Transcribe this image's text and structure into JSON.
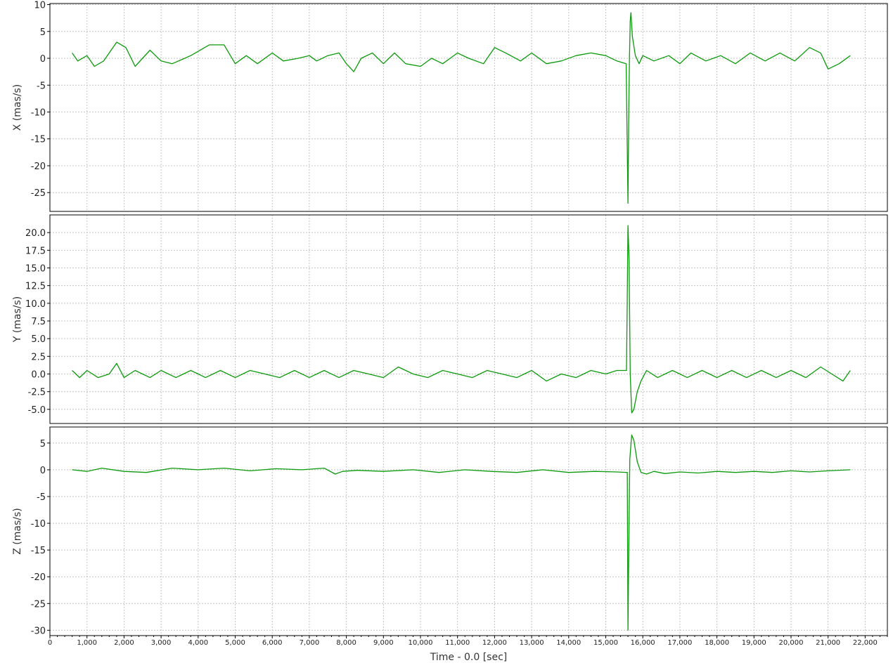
{
  "colors": {
    "series": "#0b9a0b",
    "grid": "#c4c4c4",
    "frame": "#000000"
  },
  "chart_data": {
    "type": "line",
    "grid": true,
    "legend": "none",
    "xlabel": "Time - 0.0 [sec]",
    "xlim": [
      0,
      22600
    ],
    "xticks": [
      0,
      1000,
      2000,
      3000,
      4000,
      5000,
      6000,
      7000,
      8000,
      9000,
      10000,
      11000,
      12000,
      13000,
      14000,
      15000,
      16000,
      17000,
      18000,
      19000,
      20000,
      21000,
      22000
    ],
    "xtick_labels": [
      "0",
      "1,000",
      "2,000",
      "3,000",
      "4,000",
      "5,000",
      "6,000",
      "7,000",
      "8,000",
      "9,000",
      "10,000",
      "11,000",
      "12,000",
      "13,000",
      "14,000",
      "15,000",
      "16,000",
      "17,000",
      "18,000",
      "19,000",
      "20,000",
      "21,000",
      "22,000"
    ],
    "panels": [
      {
        "ylabel": "X (mas/s)",
        "ylim": [
          -28.5,
          10.2
        ],
        "yticks": [
          10,
          5,
          0,
          -5,
          -10,
          -15,
          -20,
          -25
        ],
        "ytick_labels": [
          "10",
          "5",
          "0",
          "-5",
          "-10",
          "-15",
          "-20",
          "-25"
        ],
        "series": {
          "x": [
            600,
            750,
            1000,
            1200,
            1450,
            1800,
            2050,
            2300,
            2700,
            3000,
            3300,
            3800,
            4300,
            4700,
            5000,
            5300,
            5600,
            6000,
            6300,
            6700,
            7000,
            7200,
            7500,
            7800,
            8000,
            8200,
            8400,
            8700,
            9000,
            9300,
            9600,
            10000,
            10300,
            10600,
            11000,
            11300,
            11700,
            12000,
            12300,
            12700,
            13000,
            13400,
            13800,
            14200,
            14600,
            15000,
            15300,
            15550,
            15600,
            15620,
            15640,
            15660,
            15680,
            15720,
            15800,
            15900,
            16000,
            16300,
            16700,
            17000,
            17300,
            17700,
            18100,
            18500,
            18900,
            19300,
            19700,
            20100,
            20500,
            20800,
            21000,
            21300,
            21600
          ],
          "values": [
            1.0,
            -0.5,
            0.5,
            -1.5,
            -0.5,
            3.0,
            2.0,
            -1.5,
            1.5,
            -0.5,
            -1.0,
            0.5,
            2.5,
            2.5,
            -1.0,
            0.5,
            -1.0,
            1.0,
            -0.5,
            0.0,
            0.5,
            -0.5,
            0.5,
            1.0,
            -1.0,
            -2.5,
            0.0,
            1.0,
            -1.0,
            1.0,
            -1.0,
            -1.5,
            0.0,
            -1.0,
            1.0,
            0.0,
            -1.0,
            2.0,
            1.0,
            -0.5,
            1.0,
            -1.0,
            -0.5,
            0.5,
            1.0,
            0.5,
            -0.5,
            -1.0,
            -27.0,
            -10.0,
            0.0,
            7.0,
            8.5,
            4.0,
            0.5,
            -1.0,
            0.5,
            -0.5,
            0.5,
            -1.0,
            1.0,
            -0.5,
            0.5,
            -1.0,
            1.0,
            -0.5,
            1.0,
            -0.5,
            2.0,
            1.0,
            -2.0,
            -1.0,
            0.5
          ]
        }
      },
      {
        "ylabel": "Y (mas/s)",
        "ylim": [
          -7.0,
          22.5
        ],
        "yticks": [
          20,
          17.5,
          15,
          12.5,
          10,
          7.5,
          5,
          2.5,
          0,
          -2.5,
          -5
        ],
        "ytick_labels": [
          "20.0",
          "17.5",
          "15.0",
          "12.5",
          "10.0",
          "7.5",
          "5.0",
          "2.5",
          "0.0",
          "-2.5",
          "-5.0"
        ],
        "series": {
          "x": [
            600,
            800,
            1000,
            1300,
            1600,
            1800,
            2000,
            2300,
            2700,
            3000,
            3400,
            3800,
            4200,
            4600,
            5000,
            5400,
            5800,
            6200,
            6600,
            7000,
            7400,
            7800,
            8200,
            8600,
            9000,
            9400,
            9800,
            10200,
            10600,
            11000,
            11400,
            11800,
            12200,
            12600,
            13000,
            13400,
            13800,
            14200,
            14600,
            15000,
            15300,
            15560,
            15600,
            15630,
            15660,
            15700,
            15760,
            15850,
            15950,
            16100,
            16400,
            16800,
            17200,
            17600,
            18000,
            18400,
            18800,
            19200,
            19600,
            20000,
            20400,
            20800,
            21100,
            21400,
            21600
          ],
          "values": [
            0.5,
            -0.5,
            0.5,
            -0.5,
            0.0,
            1.5,
            -0.5,
            0.5,
            -0.5,
            0.5,
            -0.5,
            0.5,
            -0.5,
            0.5,
            -0.5,
            0.5,
            0.0,
            -0.5,
            0.5,
            -0.5,
            0.5,
            -0.5,
            0.5,
            0.0,
            -0.5,
            1.0,
            0.0,
            -0.5,
            0.5,
            0.0,
            -0.5,
            0.5,
            0.0,
            -0.5,
            0.5,
            -1.0,
            0.0,
            -0.5,
            0.5,
            0.0,
            0.5,
            0.5,
            21.0,
            16.0,
            0.0,
            -5.5,
            -5.0,
            -2.5,
            -1.0,
            0.5,
            -0.5,
            0.5,
            -0.5,
            0.5,
            -0.5,
            0.5,
            -0.5,
            0.5,
            -0.5,
            0.5,
            -0.5,
            1.0,
            0.0,
            -1.0,
            0.5
          ]
        }
      },
      {
        "ylabel": "Z (mas/s)",
        "ylim": [
          -31.0,
          8.0
        ],
        "yticks": [
          5,
          0,
          -5,
          -10,
          -15,
          -20,
          -25,
          -30
        ],
        "ytick_labels": [
          "5",
          "0",
          "-5",
          "-10",
          "-15",
          "-20",
          "-25",
          "-30"
        ],
        "series": {
          "x": [
            600,
            1000,
            1400,
            2000,
            2600,
            3300,
            4000,
            4700,
            5400,
            6100,
            6800,
            7400,
            7700,
            7900,
            8300,
            9000,
            9800,
            10500,
            11200,
            11900,
            12600,
            13300,
            14000,
            14700,
            15300,
            15580,
            15600,
            15620,
            15650,
            15700,
            15760,
            15850,
            15950,
            16100,
            16300,
            16600,
            17000,
            17500,
            18000,
            18500,
            19000,
            19500,
            20000,
            20500,
            21000,
            21600
          ],
          "values": [
            0.0,
            -0.3,
            0.3,
            -0.3,
            -0.5,
            0.3,
            0.0,
            0.3,
            -0.2,
            0.2,
            0.0,
            0.3,
            -0.8,
            -0.3,
            -0.1,
            -0.3,
            0.0,
            -0.5,
            0.0,
            -0.3,
            -0.5,
            0.0,
            -0.5,
            -0.3,
            -0.4,
            -0.5,
            -30.0,
            -15.0,
            2.0,
            6.5,
            5.5,
            1.5,
            -0.5,
            -0.8,
            -0.3,
            -0.7,
            -0.4,
            -0.6,
            -0.3,
            -0.5,
            -0.3,
            -0.5,
            -0.2,
            -0.4,
            -0.2,
            0.0
          ]
        }
      }
    ]
  }
}
